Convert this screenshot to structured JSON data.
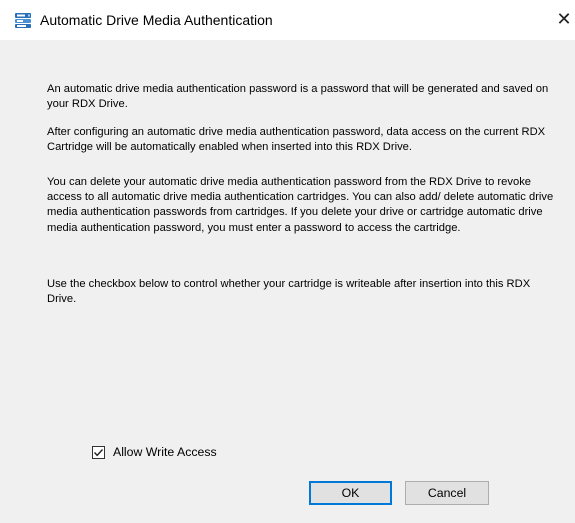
{
  "window": {
    "title": "Automatic Drive Media Authentication",
    "title_icon": "rdx-drive-icon",
    "close_glyph": "✕"
  },
  "content": {
    "paragraphs": [
      "An automatic drive media authentication password is a password that will be generated and saved on your RDX Drive.",
      "After configuring an automatic drive media authentication password, data access on the current RDX Cartridge will be automatically enabled when inserted into this RDX Drive.",
      "You can delete your automatic drive media authentication password from the RDX Drive to revoke access to all automatic drive media authentication cartridges. You can also add/ delete automatic drive media authentication passwords from cartridges. If you delete your drive or cartridge automatic drive media authentication password, you must enter a password to access the cartridge.",
      "Use the checkbox below to control whether your cartridge is writeable after insertion into this RDX Drive."
    ]
  },
  "checkbox": {
    "label": "Allow Write Access",
    "checked": true
  },
  "buttons": {
    "ok": "OK",
    "cancel": "Cancel"
  },
  "colors": {
    "dialog_background": "#f0f0f0",
    "titlebar_background": "#ffffff",
    "button_face": "#e1e1e1",
    "default_button_border": "#0078d7",
    "icon_blue": "#2a6fb8"
  }
}
